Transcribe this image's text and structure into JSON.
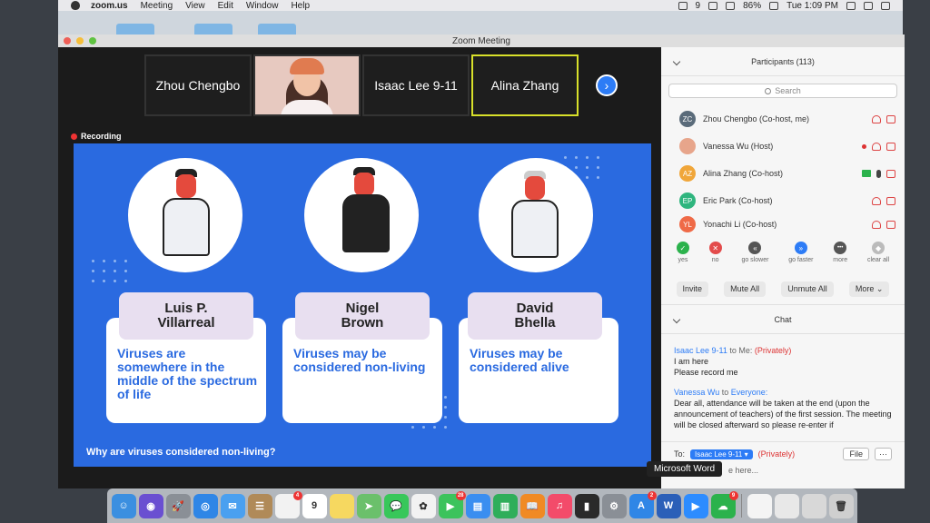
{
  "menubar": {
    "app": "zoom.us",
    "menus": [
      "Meeting",
      "View",
      "Edit",
      "Window",
      "Help"
    ],
    "notif_count": "9",
    "battery": "86%",
    "clock": "Tue 1:09 PM"
  },
  "window": {
    "title": "Zoom Meeting"
  },
  "videos": {
    "tiles": [
      "Zhou Chengbo",
      "Isaac Lee 9-11",
      "Alina Zhang"
    ],
    "next_arrow_icon": "chevron-right-icon"
  },
  "recording": {
    "label": "Recording"
  },
  "slide": {
    "cards": [
      {
        "name": "Luis P.\nVillarreal",
        "text": "Viruses are somewhere in the middle of the spectrum of life"
      },
      {
        "name": "Nigel\nBrown",
        "text": "Viruses may be considered non-living"
      },
      {
        "name": "David\nBhella",
        "text": "Viruses may be considered alive"
      }
    ],
    "question": "Why are viruses considered non-living?"
  },
  "participants": {
    "title": "Participants (113)",
    "search_placeholder": "Search",
    "list": [
      {
        "initials": "ZC",
        "name": "Zhou Chengbo (Co-host, me)",
        "color": "#5a6b7a"
      },
      {
        "initials": "",
        "name": "Vanessa Wu (Host)",
        "color": "#e7a58b"
      },
      {
        "initials": "AZ",
        "name": "Alina Zhang (Co-host)",
        "color": "#f0a63a"
      },
      {
        "initials": "EP",
        "name": "Eric Park (Co-host)",
        "color": "#2fb57e"
      },
      {
        "initials": "YL",
        "name": "Yonachi Li (Co-host)",
        "color": "#ef6a47"
      }
    ],
    "reactions": [
      {
        "label": "yes",
        "glyph": "✓",
        "color": "#2bb24c"
      },
      {
        "label": "no",
        "glyph": "✕",
        "color": "#e34b4b"
      },
      {
        "label": "go slower",
        "glyph": "«",
        "color": "#555"
      },
      {
        "label": "go faster",
        "glyph": "»",
        "color": "#2d7cf6"
      },
      {
        "label": "more",
        "glyph": "•••",
        "color": "#555"
      },
      {
        "label": "clear all",
        "glyph": "◆",
        "color": "#bbb"
      }
    ],
    "buttons": {
      "invite": "Invite",
      "mute_all": "Mute All",
      "unmute_all": "Unmute All",
      "more": "More ⌄"
    }
  },
  "chat": {
    "title": "Chat",
    "messages": [
      {
        "from": "Isaac Lee 9-11",
        "mid": " to Me: ",
        "to": "(Privately)",
        "lines": [
          "I am here",
          "Please record me"
        ]
      },
      {
        "from": "Vanessa Wu",
        "mid": " to ",
        "to": "Everyone:",
        "lines": [
          "Dear all, attendance will be taken at the end (upon the announcement of teachers) of the first session. The meeting will be closed afterward so please re-enter if"
        ]
      }
    ],
    "to_label": "To:",
    "to_value": "Isaac Lee 9-11 ▾",
    "privately": "(Privately)",
    "file_btn": "File",
    "more_btn": "···",
    "type_hint": "e here..."
  },
  "tooltip": "Microsoft Word",
  "dock": {
    "icons": [
      {
        "name": "finder",
        "color": "#3b8fe0",
        "glyph": "☺"
      },
      {
        "name": "siri",
        "color": "#6a4fd1",
        "glyph": "◉"
      },
      {
        "name": "launchpad",
        "color": "#8a8f96",
        "glyph": "🚀"
      },
      {
        "name": "safari",
        "color": "#2f86e6",
        "glyph": "◎"
      },
      {
        "name": "mail",
        "color": "#4aa0f0",
        "glyph": "✉"
      },
      {
        "name": "contacts",
        "color": "#b08a58",
        "glyph": "☰"
      },
      {
        "name": "reminders",
        "color": "#f2f2f2",
        "glyph": "",
        "badge": "4"
      },
      {
        "name": "calendar",
        "color": "#ffffff",
        "glyph": "9"
      },
      {
        "name": "notes",
        "color": "#f6d860",
        "glyph": ""
      },
      {
        "name": "maps",
        "color": "#6bc06b",
        "glyph": "➤"
      },
      {
        "name": "messages",
        "color": "#38c75a",
        "glyph": "💬"
      },
      {
        "name": "photos",
        "color": "#f2f2f2",
        "glyph": "✿"
      },
      {
        "name": "facetime",
        "color": "#3cc35c",
        "glyph": "▶",
        "badge": "28"
      },
      {
        "name": "keynote",
        "color": "#3a8ef0",
        "glyph": "▤"
      },
      {
        "name": "numbers",
        "color": "#2fae5a",
        "glyph": "▥"
      },
      {
        "name": "books",
        "color": "#f08a24",
        "glyph": "📖"
      },
      {
        "name": "music",
        "color": "#f34b6a",
        "glyph": "♫"
      },
      {
        "name": "stocks",
        "color": "#2a2a2a",
        "glyph": "▮"
      },
      {
        "name": "system-preferences",
        "color": "#8a8f96",
        "glyph": "⚙"
      },
      {
        "name": "app-store",
        "color": "#2f86e6",
        "glyph": "A",
        "badge": "2"
      },
      {
        "name": "microsoft-word",
        "color": "#2b5fb8",
        "glyph": "W"
      },
      {
        "name": "zoom",
        "color": "#2d8cff",
        "glyph": "▶"
      },
      {
        "name": "wechat",
        "color": "#2bb24c",
        "glyph": "☁",
        "badge": "9"
      }
    ],
    "after_sep": [
      {
        "name": "document-1",
        "color": "#f4f4f4",
        "glyph": ""
      },
      {
        "name": "document-2",
        "color": "#e8e8e8",
        "glyph": ""
      },
      {
        "name": "downloads",
        "color": "#d8d8d8",
        "glyph": ""
      },
      {
        "name": "trash",
        "color": "#cfcfcf",
        "glyph": "🗑"
      }
    ]
  }
}
